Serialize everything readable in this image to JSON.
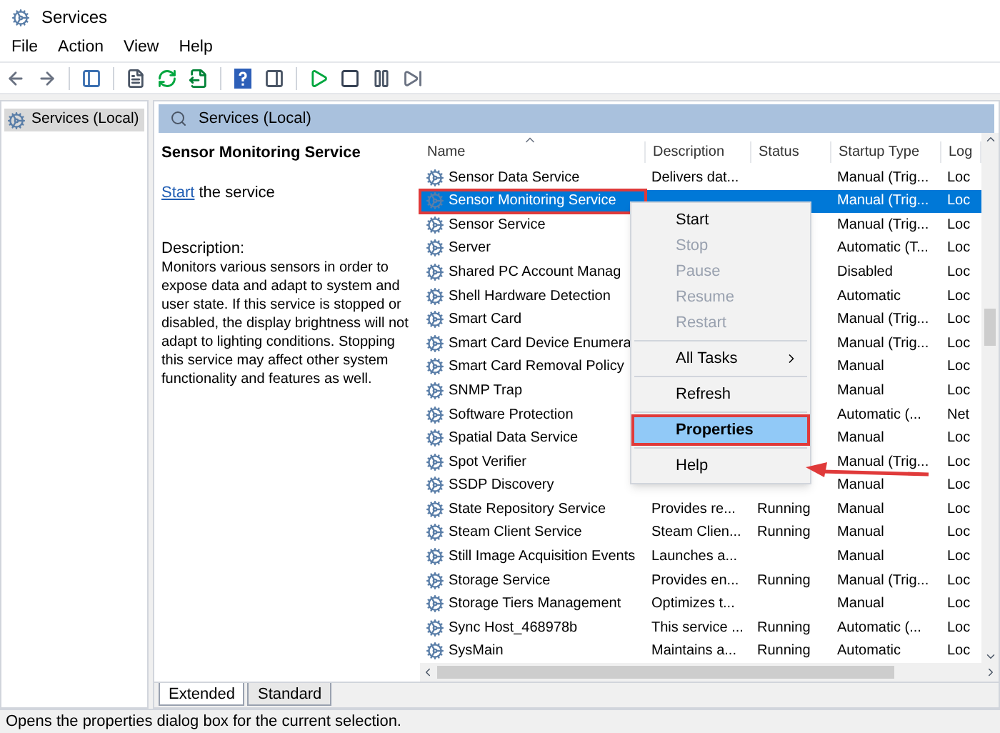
{
  "window": {
    "title": "Services"
  },
  "menu": [
    "File",
    "Action",
    "View",
    "Help"
  ],
  "tree": [
    {
      "label": "Services (Local)",
      "selected": true
    }
  ],
  "panel_header": "Services (Local)",
  "detail": {
    "title": "Sensor Monitoring Service",
    "link": "Start",
    "link_suffix": "the service",
    "description_label": "Description:",
    "description": "Monitors various sensors in order to expose data and adapt to system and user state.  If this service is stopped or disabled, the display brightness will not adapt to lighting conditions. Stopping this service may affect other system functionality and features as well."
  },
  "table": {
    "columns": [
      "Name",
      "Description",
      "Status",
      "Startup Type",
      "Log"
    ],
    "rows": [
      {
        "name": "Sensor Data Service",
        "description": "Delivers dat...",
        "startup": "Manual (Trig...",
        "log": "Loc",
        "selected": false
      },
      {
        "name": "Sensor Monitoring Service",
        "startup": "Manual (Trig...",
        "log": "Loc",
        "selected": true
      },
      {
        "name": "Sensor Service",
        "startup": "Manual (Trig...",
        "log": "Loc",
        "selected": false
      },
      {
        "name": "Server",
        "startup": "Automatic (T...",
        "log": "Loc",
        "selected": false
      },
      {
        "name": "Shared PC Account Manag",
        "startup": "Disabled",
        "log": "Loc",
        "selected": false
      },
      {
        "name": "Shell Hardware Detection",
        "startup": "Automatic",
        "log": "Loc",
        "selected": false
      },
      {
        "name": "Smart Card",
        "startup": "Manual (Trig...",
        "log": "Loc",
        "selected": false
      },
      {
        "name": "Smart Card Device Enumera",
        "startup": "Manual (Trig...",
        "log": "Loc",
        "selected": false
      },
      {
        "name": "Smart Card Removal Policy",
        "startup": "Manual",
        "log": "Loc",
        "selected": false
      },
      {
        "name": "SNMP Trap",
        "startup": "Manual",
        "log": "Loc",
        "selected": false
      },
      {
        "name": "Software Protection",
        "startup": "Automatic (...",
        "log": "Net",
        "selected": false
      },
      {
        "name": "Spatial Data Service",
        "startup": "Manual",
        "log": "Loc",
        "selected": false
      },
      {
        "name": "Spot Verifier",
        "startup": "Manual (Trig...",
        "log": "Loc",
        "selected": false
      },
      {
        "name": "SSDP Discovery",
        "startup": "Manual",
        "log": "Loc",
        "selected": false
      },
      {
        "name": "State Repository Service",
        "description": "Provides re...",
        "status": "Running",
        "startup": "Manual",
        "log": "Loc",
        "selected": false
      },
      {
        "name": "Steam Client Service",
        "description": "Steam Clien...",
        "status": "Running",
        "startup": "Manual",
        "log": "Loc",
        "selected": false
      },
      {
        "name": "Still Image Acquisition Events",
        "description": "Launches a...",
        "startup": "Manual",
        "log": "Loc",
        "selected": false
      },
      {
        "name": "Storage Service",
        "description": "Provides en...",
        "status": "Running",
        "startup": "Manual (Trig...",
        "log": "Loc",
        "selected": false
      },
      {
        "name": "Storage Tiers Management",
        "description": "Optimizes t...",
        "startup": "Manual",
        "log": "Loc",
        "selected": false
      },
      {
        "name": "Sync Host_468978b",
        "description": "This service ...",
        "status": "Running",
        "startup": "Automatic (...",
        "log": "Loc",
        "selected": false
      },
      {
        "name": "SysMain",
        "description": "Maintains a...",
        "status": "Running",
        "startup": "Automatic",
        "log": "Loc",
        "selected": false
      }
    ]
  },
  "context_menu": [
    {
      "kind": "item",
      "label": "Start",
      "disabled": false,
      "selected": false
    },
    {
      "kind": "item",
      "label": "Stop",
      "disabled": true,
      "selected": false
    },
    {
      "kind": "item",
      "label": "Pause",
      "disabled": true,
      "selected": false
    },
    {
      "kind": "item",
      "label": "Resume",
      "disabled": true,
      "selected": false
    },
    {
      "kind": "item",
      "label": "Restart",
      "disabled": true,
      "selected": false
    },
    {
      "kind": "separator"
    },
    {
      "kind": "submenu",
      "label": "All Tasks",
      "disabled": false,
      "selected": false
    },
    {
      "kind": "separator"
    },
    {
      "kind": "item",
      "label": "Refresh",
      "disabled": false,
      "selected": false
    },
    {
      "kind": "separator"
    },
    {
      "kind": "item",
      "label": "Properties",
      "disabled": false,
      "selected": true
    },
    {
      "kind": "separator"
    },
    {
      "kind": "item",
      "label": "Help",
      "disabled": false,
      "selected": false
    }
  ],
  "tabs": [
    {
      "label": "Extended",
      "selected": true
    },
    {
      "label": "Standard",
      "selected": false
    }
  ],
  "status_bar": "Opens the properties dialog box for the current selection."
}
